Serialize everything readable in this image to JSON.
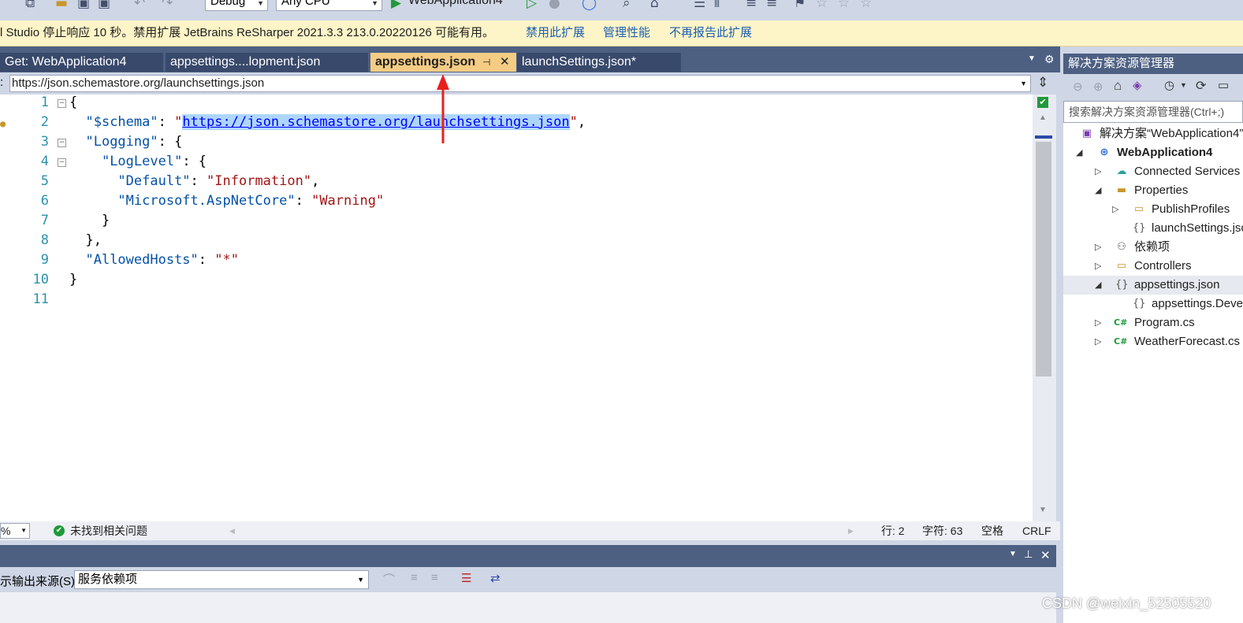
{
  "toolbar": {
    "config": "Debug",
    "platform": "Any CPU",
    "run_target": "WebApplication4"
  },
  "infobar": {
    "message": "l Studio 停止响应 10 秒。禁用扩展 JetBrains ReSharper 2021.3.3 213.0.20220126 可能有用。",
    "link_disable": "禁用此扩展",
    "link_manage": "管理性能",
    "link_noreport": "不再报告此扩展"
  },
  "tabs": [
    {
      "label": "Get: WebApplication4"
    },
    {
      "label": "appsettings....lopment.json"
    },
    {
      "label": "appsettings.json"
    },
    {
      "label": "launchSettings.json*"
    }
  ],
  "navbar": {
    "prefix": ":",
    "schema_url": "https://json.schemastore.org/launchsettings.json"
  },
  "editor": {
    "line_numbers": [
      "1",
      "2",
      "3",
      "4",
      "5",
      "6",
      "7",
      "8",
      "9",
      "10",
      "11"
    ],
    "lines": [
      "{",
      "  \"$schema\": \"https://json.schemastore.org/launchsettings.json\",",
      "  \"Logging\": {",
      "    \"LogLevel\": {",
      "      \"Default\": \"Information\",",
      "      \"Microsoft.AspNetCore\": \"Warning\"",
      "    }",
      "  },",
      "  \"AllowedHosts\": \"*\"",
      "}",
      ""
    ]
  },
  "status": {
    "zoom": "%",
    "issues": "未找到相关问题",
    "line": "行: 2",
    "char": "字符: 63",
    "indent": "空格",
    "eol": "CRLF"
  },
  "output": {
    "source_label": "示输出来源(S):",
    "source_value": "服务依赖项"
  },
  "solution_explorer": {
    "title": "解决方案资源管理器",
    "search_placeholder": "搜索解决方案资源管理器(Ctrl+;)",
    "items": [
      {
        "label": "解决方案“WebApplication4”"
      },
      {
        "label": "WebApplication4"
      },
      {
        "label": "Connected Services"
      },
      {
        "label": "Properties"
      },
      {
        "label": "PublishProfiles"
      },
      {
        "label": "launchSettings.json"
      },
      {
        "label": "依赖项"
      },
      {
        "label": "Controllers"
      },
      {
        "label": "appsettings.json"
      },
      {
        "label": "appsettings.Development.json"
      },
      {
        "label": "Program.cs"
      },
      {
        "label": "WeatherForecast.cs"
      }
    ]
  },
  "watermark": "CSDN @weixin_52505520",
  "colors": {
    "tab_active": "#f5cc84",
    "tab_strip": "#4d6082",
    "infobar": "#fdf4c7",
    "annotation_arrow": "#e8201c"
  }
}
